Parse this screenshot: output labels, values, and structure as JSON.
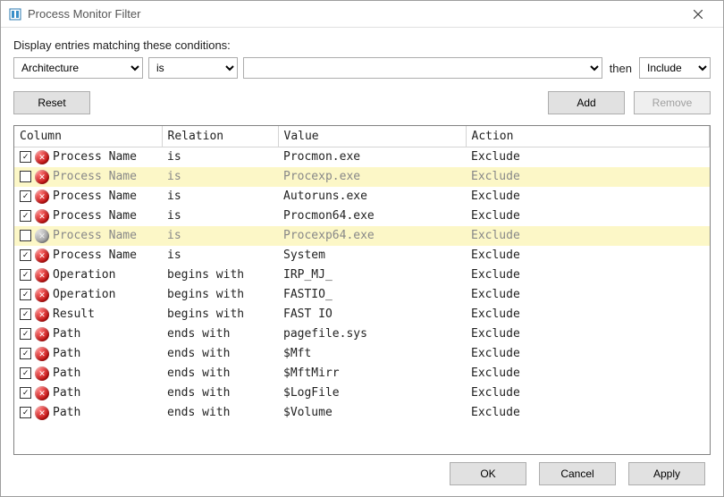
{
  "window": {
    "title": "Process Monitor Filter"
  },
  "instruction": "Display entries matching these conditions:",
  "filter": {
    "column_selected": "Architecture",
    "relation_selected": "is",
    "value": "",
    "then_label": "then",
    "action_selected": "Include"
  },
  "buttons": {
    "reset": "Reset",
    "add": "Add",
    "remove": "Remove",
    "ok": "OK",
    "cancel": "Cancel",
    "apply": "Apply"
  },
  "table": {
    "headers": {
      "column": "Column",
      "relation": "Relation",
      "value": "Value",
      "action": "Action"
    },
    "rows": [
      {
        "checked": true,
        "icon": "exclude",
        "column": "Process Name",
        "relation": "is",
        "value": "Procmon.exe",
        "action": "Exclude",
        "highlight": false
      },
      {
        "checked": false,
        "icon": "exclude",
        "column": "Process Name",
        "relation": "is",
        "value": "Procexp.exe",
        "action": "Exclude",
        "highlight": true
      },
      {
        "checked": true,
        "icon": "exclude",
        "column": "Process Name",
        "relation": "is",
        "value": "Autoruns.exe",
        "action": "Exclude",
        "highlight": false
      },
      {
        "checked": true,
        "icon": "exclude",
        "column": "Process Name",
        "relation": "is",
        "value": "Procmon64.exe",
        "action": "Exclude",
        "highlight": false
      },
      {
        "checked": false,
        "icon": "dim",
        "column": "Process Name",
        "relation": "is",
        "value": "Procexp64.exe",
        "action": "Exclude",
        "highlight": true
      },
      {
        "checked": true,
        "icon": "exclude",
        "column": "Process Name",
        "relation": "is",
        "value": "System",
        "action": "Exclude",
        "highlight": false
      },
      {
        "checked": true,
        "icon": "exclude",
        "column": "Operation",
        "relation": "begins with",
        "value": "IRP_MJ_",
        "action": "Exclude",
        "highlight": false
      },
      {
        "checked": true,
        "icon": "exclude",
        "column": "Operation",
        "relation": "begins with",
        "value": "FASTIO_",
        "action": "Exclude",
        "highlight": false
      },
      {
        "checked": true,
        "icon": "exclude",
        "column": "Result",
        "relation": "begins with",
        "value": "FAST IO",
        "action": "Exclude",
        "highlight": false
      },
      {
        "checked": true,
        "icon": "exclude",
        "column": "Path",
        "relation": "ends with",
        "value": "pagefile.sys",
        "action": "Exclude",
        "highlight": false
      },
      {
        "checked": true,
        "icon": "exclude",
        "column": "Path",
        "relation": "ends with",
        "value": "$Mft",
        "action": "Exclude",
        "highlight": false
      },
      {
        "checked": true,
        "icon": "exclude",
        "column": "Path",
        "relation": "ends with",
        "value": "$MftMirr",
        "action": "Exclude",
        "highlight": false
      },
      {
        "checked": true,
        "icon": "exclude",
        "column": "Path",
        "relation": "ends with",
        "value": "$LogFile",
        "action": "Exclude",
        "highlight": false
      },
      {
        "checked": true,
        "icon": "exclude",
        "column": "Path",
        "relation": "ends with",
        "value": "$Volume",
        "action": "Exclude",
        "highlight": false
      }
    ]
  }
}
